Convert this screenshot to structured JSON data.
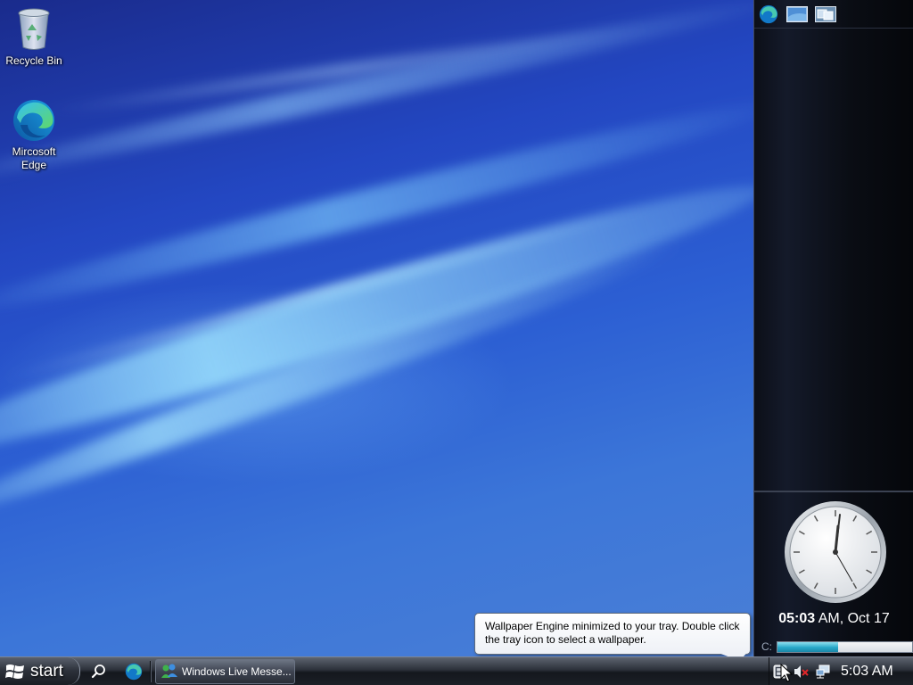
{
  "desktop": {
    "icons": [
      {
        "label": "Recycle Bin",
        "icon": "recycle-bin-icon"
      },
      {
        "label": "Mircosoft Edge",
        "icon": "edge-icon"
      }
    ]
  },
  "sidebar": {
    "top_buttons": [
      "edge-icon",
      "desktop-icon",
      "switch-windows-icon"
    ],
    "clock": {
      "time_bold": "05:03",
      "rest": " AM, Oct 17"
    },
    "drive": {
      "label": "C:",
      "used_fraction": 0.45
    }
  },
  "notification": {
    "text": "Wallpaper Engine minimized to your tray. Double click the tray icon to select a wallpaper."
  },
  "taskbar": {
    "start_label": "start",
    "quick_launch": [
      "search-icon",
      "edge-icon"
    ],
    "tasks": [
      {
        "label": "Windows Live Messe...",
        "icon": "messenger-icon"
      }
    ],
    "tray": {
      "icons": [
        "wallpaper-engine-icon",
        "volume-muted-icon",
        "network-icon"
      ],
      "time": "5:03 AM"
    }
  },
  "colors": {
    "accent": "#2c5fd3",
    "drive_fill": "#27a7c7"
  }
}
